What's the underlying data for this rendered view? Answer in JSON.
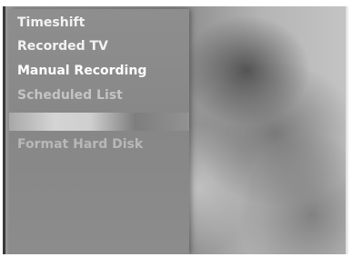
{
  "menu": {
    "items": [
      {
        "label": "Timeshift"
      },
      {
        "label": "Recorded TV"
      },
      {
        "label": "Manual Recording"
      },
      {
        "label": "Scheduled List"
      },
      {
        "label": ""
      },
      {
        "label": "Format Hard Disk"
      }
    ],
    "colors": {
      "panel": "#888888",
      "text_active": "#ffffff",
      "text_dimmed": "#c4c4c4"
    }
  }
}
